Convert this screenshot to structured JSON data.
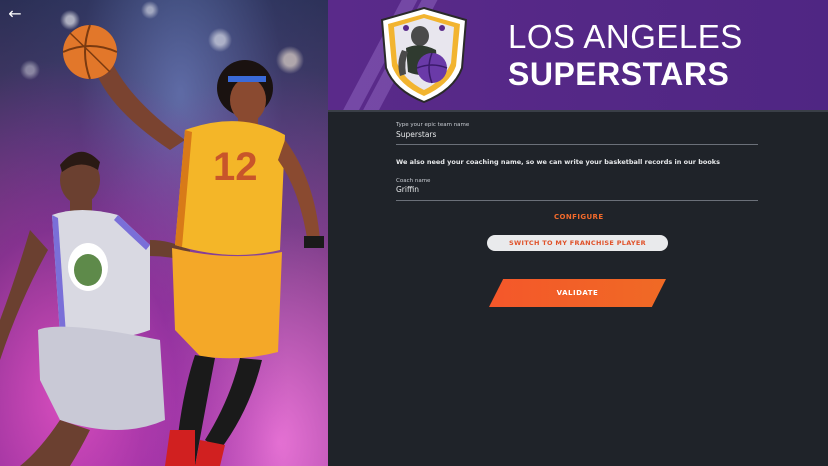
{
  "nav": {
    "back_icon": "arrow-left-icon"
  },
  "header": {
    "city": "LOS ANGELES",
    "team": "SUPERSTARS",
    "crest_icon": "team-crest-icon",
    "colors": {
      "primary": "#4f2683",
      "accent": "#f26a2b"
    }
  },
  "form": {
    "team_name": {
      "label": "Type your epic team name",
      "value": "Superstars"
    },
    "info": "We also need your coaching name, so we can write your basketball records in our books",
    "coach_name": {
      "label": "Coach name",
      "value": "Griffin"
    },
    "configure_label": "CONFIGURE",
    "switch_label": "SWITCH TO MY FRANCHISE PLAYER",
    "validate_label": "VALIDATE"
  },
  "artwork": {
    "jersey_number": "12"
  }
}
